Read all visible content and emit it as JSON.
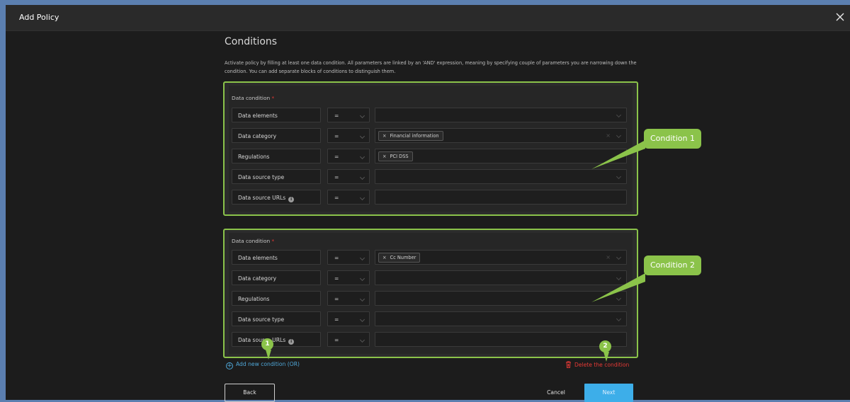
{
  "header": {
    "title": "Add Policy"
  },
  "section": {
    "title": "Conditions",
    "description": "Activate policy by filling at least one data condition. All parameters are linked by an 'AND' expression, meaning by specifying couple of parameters you are narrowing down the condition. You can add separate blocks of conditions to distinguish them."
  },
  "conditions": [
    {
      "label": "Data condition",
      "required_mark": "*",
      "rows": [
        {
          "param": "Data elements",
          "operator": "=",
          "tag": ""
        },
        {
          "param": "Data category",
          "operator": "=",
          "tag": "Financial information"
        },
        {
          "param": "Regulations",
          "operator": "=",
          "tag": "PCI DSS"
        },
        {
          "param": "Data source type",
          "operator": "=",
          "tag": ""
        },
        {
          "param": "Data source URLs",
          "operator": "=",
          "tag": ""
        }
      ]
    },
    {
      "label": "Data condition",
      "required_mark": "*",
      "rows": [
        {
          "param": "Data elements",
          "operator": "=",
          "tag": "Cc Number"
        },
        {
          "param": "Data category",
          "operator": "=",
          "tag": ""
        },
        {
          "param": "Regulations",
          "operator": "=",
          "tag": ""
        },
        {
          "param": "Data source type",
          "operator": "=",
          "tag": ""
        },
        {
          "param": "Data source URLs",
          "operator": "=",
          "tag": ""
        }
      ]
    }
  ],
  "callouts": [
    "Condition 1",
    "Condition 2"
  ],
  "badges": [
    "1",
    "2"
  ],
  "actions": {
    "add_condition": "Add new condition (OR)",
    "delete_condition": "Delete the condition",
    "back": "Back",
    "cancel": "Cancel",
    "next": "Next"
  },
  "info_glyph": "i",
  "tag_remove_glyph": "×",
  "clear_glyph": "×",
  "colors": {
    "accent_green": "#8bc34a",
    "link_blue": "#4fa8d9",
    "danger_red": "#e53935",
    "primary_button": "#3daee9"
  }
}
